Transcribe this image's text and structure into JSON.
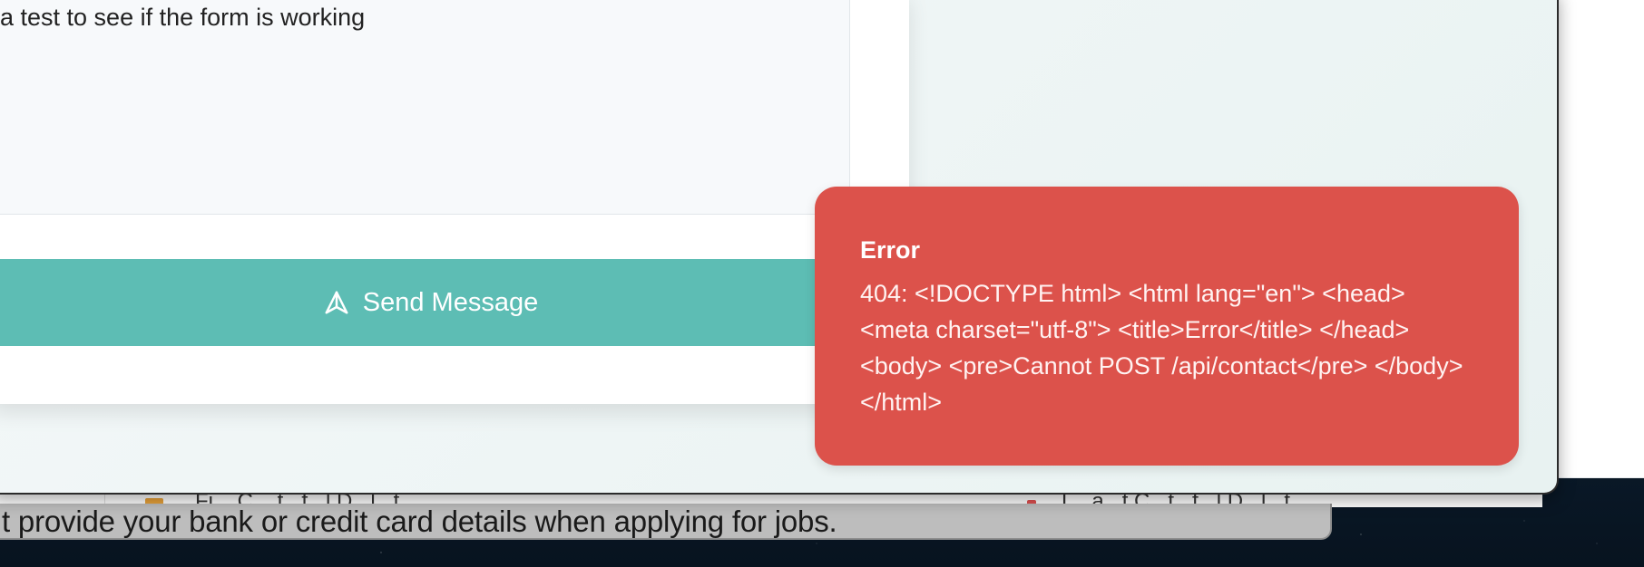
{
  "form": {
    "message_value": "a test to see if the form is working",
    "send_button_label": "Send Message",
    "send_icon": "send-icon"
  },
  "toast": {
    "title": "Error",
    "message": "404: <!DOCTYPE html> <html lang=\"en\"> <head> <meta charset=\"utf-8\"> <title>Error</title> </head> <body> <pre>Cannot POST /api/contact</pre> </body> </html>",
    "color": "#dc524b"
  },
  "notification_bar": {
    "text": "t provide your bank or credit card details when applying for jobs."
  },
  "back_window": {
    "tabs": [
      "Fi... C... t...f...l D...l...t...",
      "L...a...t C...t...f...l D...l...t..."
    ]
  },
  "colors": {
    "accent": "#5dbdb4",
    "error": "#dc524b"
  }
}
